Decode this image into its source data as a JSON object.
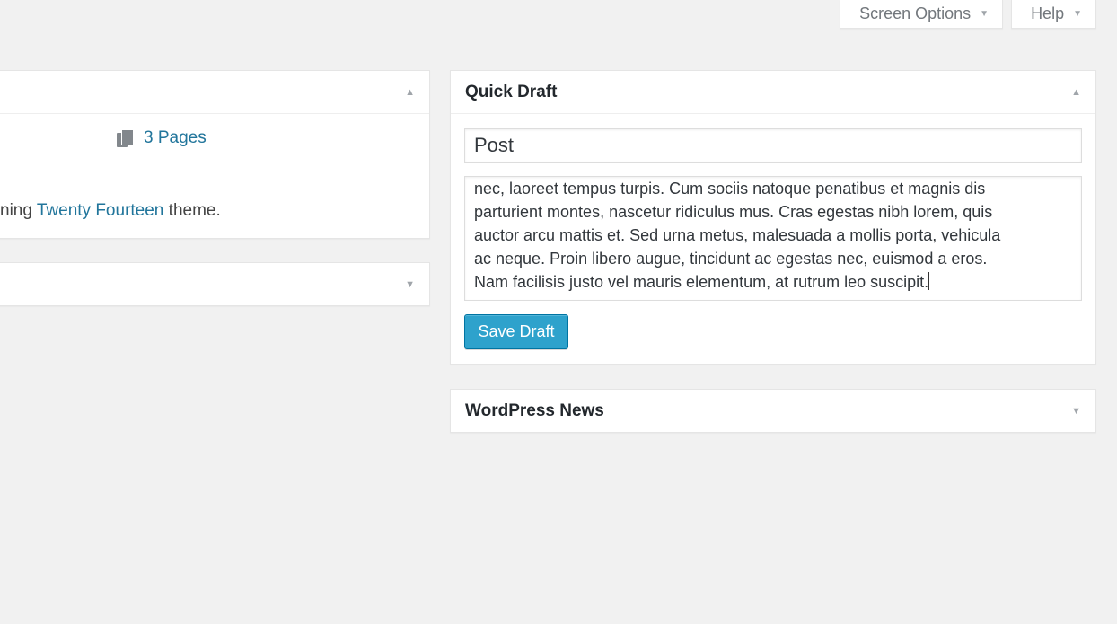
{
  "screen_meta": {
    "screen_options_label": "Screen Options",
    "help_label": "Help"
  },
  "glance": {
    "pages_label": "3 Pages",
    "theme_prefix": "ning ",
    "theme_link": "Twenty Fourteen",
    "theme_suffix": " theme."
  },
  "quick_draft": {
    "title": "Quick Draft",
    "title_value": "Post",
    "content_lines": [
      "nec, laoreet tempus turpis. Cum sociis natoque penatibus et magnis dis",
      "parturient montes, nascetur ridiculus mus. Cras egestas nibh lorem, quis",
      "auctor arcu mattis et. Sed urna metus, malesuada a mollis porta, vehicula",
      "ac neque. Proin libero augue, tincidunt ac egestas nec, euismod a eros.",
      "Nam facilisis justo vel mauris elementum, at rutrum leo suscipit."
    ],
    "save_label": "Save Draft"
  },
  "news": {
    "title": "WordPress News"
  },
  "colors": {
    "background": "#f1f1f1",
    "link": "#21759b",
    "button": "#2ea2cc"
  }
}
